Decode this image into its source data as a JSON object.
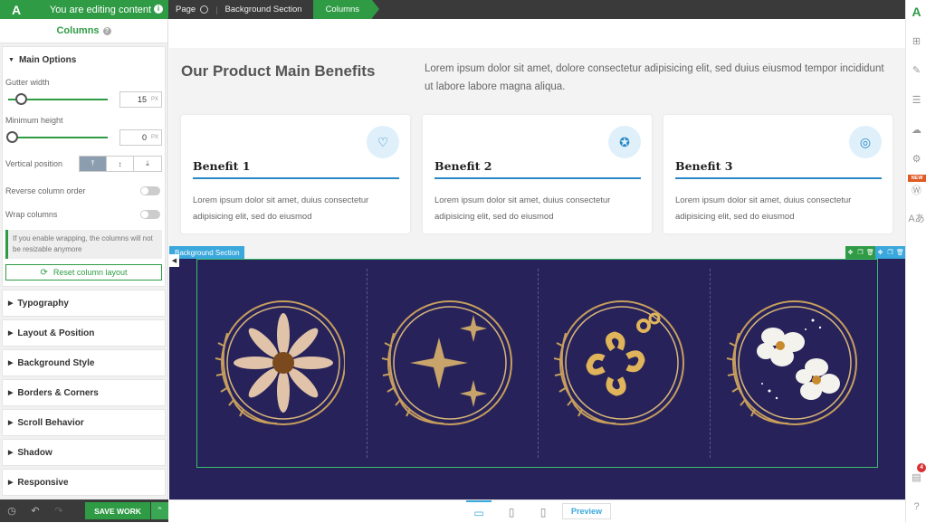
{
  "topbar": {
    "logo": "A",
    "editing_label": "You are editing content",
    "breadcrumbs": [
      "Page",
      "Background Section",
      "Columns"
    ]
  },
  "sidebar": {
    "title": "Columns",
    "main_options": {
      "header": "Main Options",
      "gutter_label": "Gutter width",
      "gutter_value": "15",
      "gutter_unit": "PX",
      "min_height_label": "Minimum height",
      "min_height_value": "0",
      "min_height_unit": "PX",
      "vertical_position_label": "Vertical position",
      "vertical_position_selected": "top",
      "reverse_label": "Reverse column order",
      "wrap_label": "Wrap columns",
      "note": "If you enable wrapping, the columns will not be resizable anymore",
      "reset_label": "Reset column layout"
    },
    "sections": [
      "Typography",
      "Layout & Position",
      "Background Style",
      "Borders & Corners",
      "Scroll Behavior",
      "Shadow",
      "Responsive"
    ]
  },
  "bottom": {
    "save_label": "SAVE WORK"
  },
  "canvas": {
    "heading": "Our Product Main Benefits",
    "intro": "Lorem ipsum dolor sit amet, dolore consectetur adipisicing elit, sed duius eiusmod tempor incididunt ut labore labore magna aliqua.",
    "cards": [
      {
        "title": "Benefit 1",
        "text": "Lorem ipsum dolor sit amet, duius consectetur adipisicing elit, sed do eiusmod",
        "icon": "book-heart-icon"
      },
      {
        "title": "Benefit 2",
        "text": "Lorem ipsum dolor sit amet, duius consectetur adipisicing elit, sed do eiusmod",
        "icon": "award-ribbon-icon"
      },
      {
        "title": "Benefit 3",
        "text": "Lorem ipsum dolor sit amet, duius consectetur adipisicing elit, sed do eiusmod",
        "icon": "fingerprint-icon"
      }
    ],
    "bg_section_tag": "Background Section",
    "bg_color": "#27235a",
    "emblems": [
      "daisy-emblem",
      "sparkle-emblem",
      "gold-flower-emblem",
      "white-blossom-emblem"
    ]
  },
  "devices": {
    "selected": "desktop",
    "preview_label": "Preview"
  },
  "right_bar": {
    "new_badge": "NEW",
    "notification_count": "4"
  },
  "colors": {
    "accent_green": "#2f9b45",
    "accent_blue": "#3aa8dc",
    "dark": "#3a3a3a"
  }
}
